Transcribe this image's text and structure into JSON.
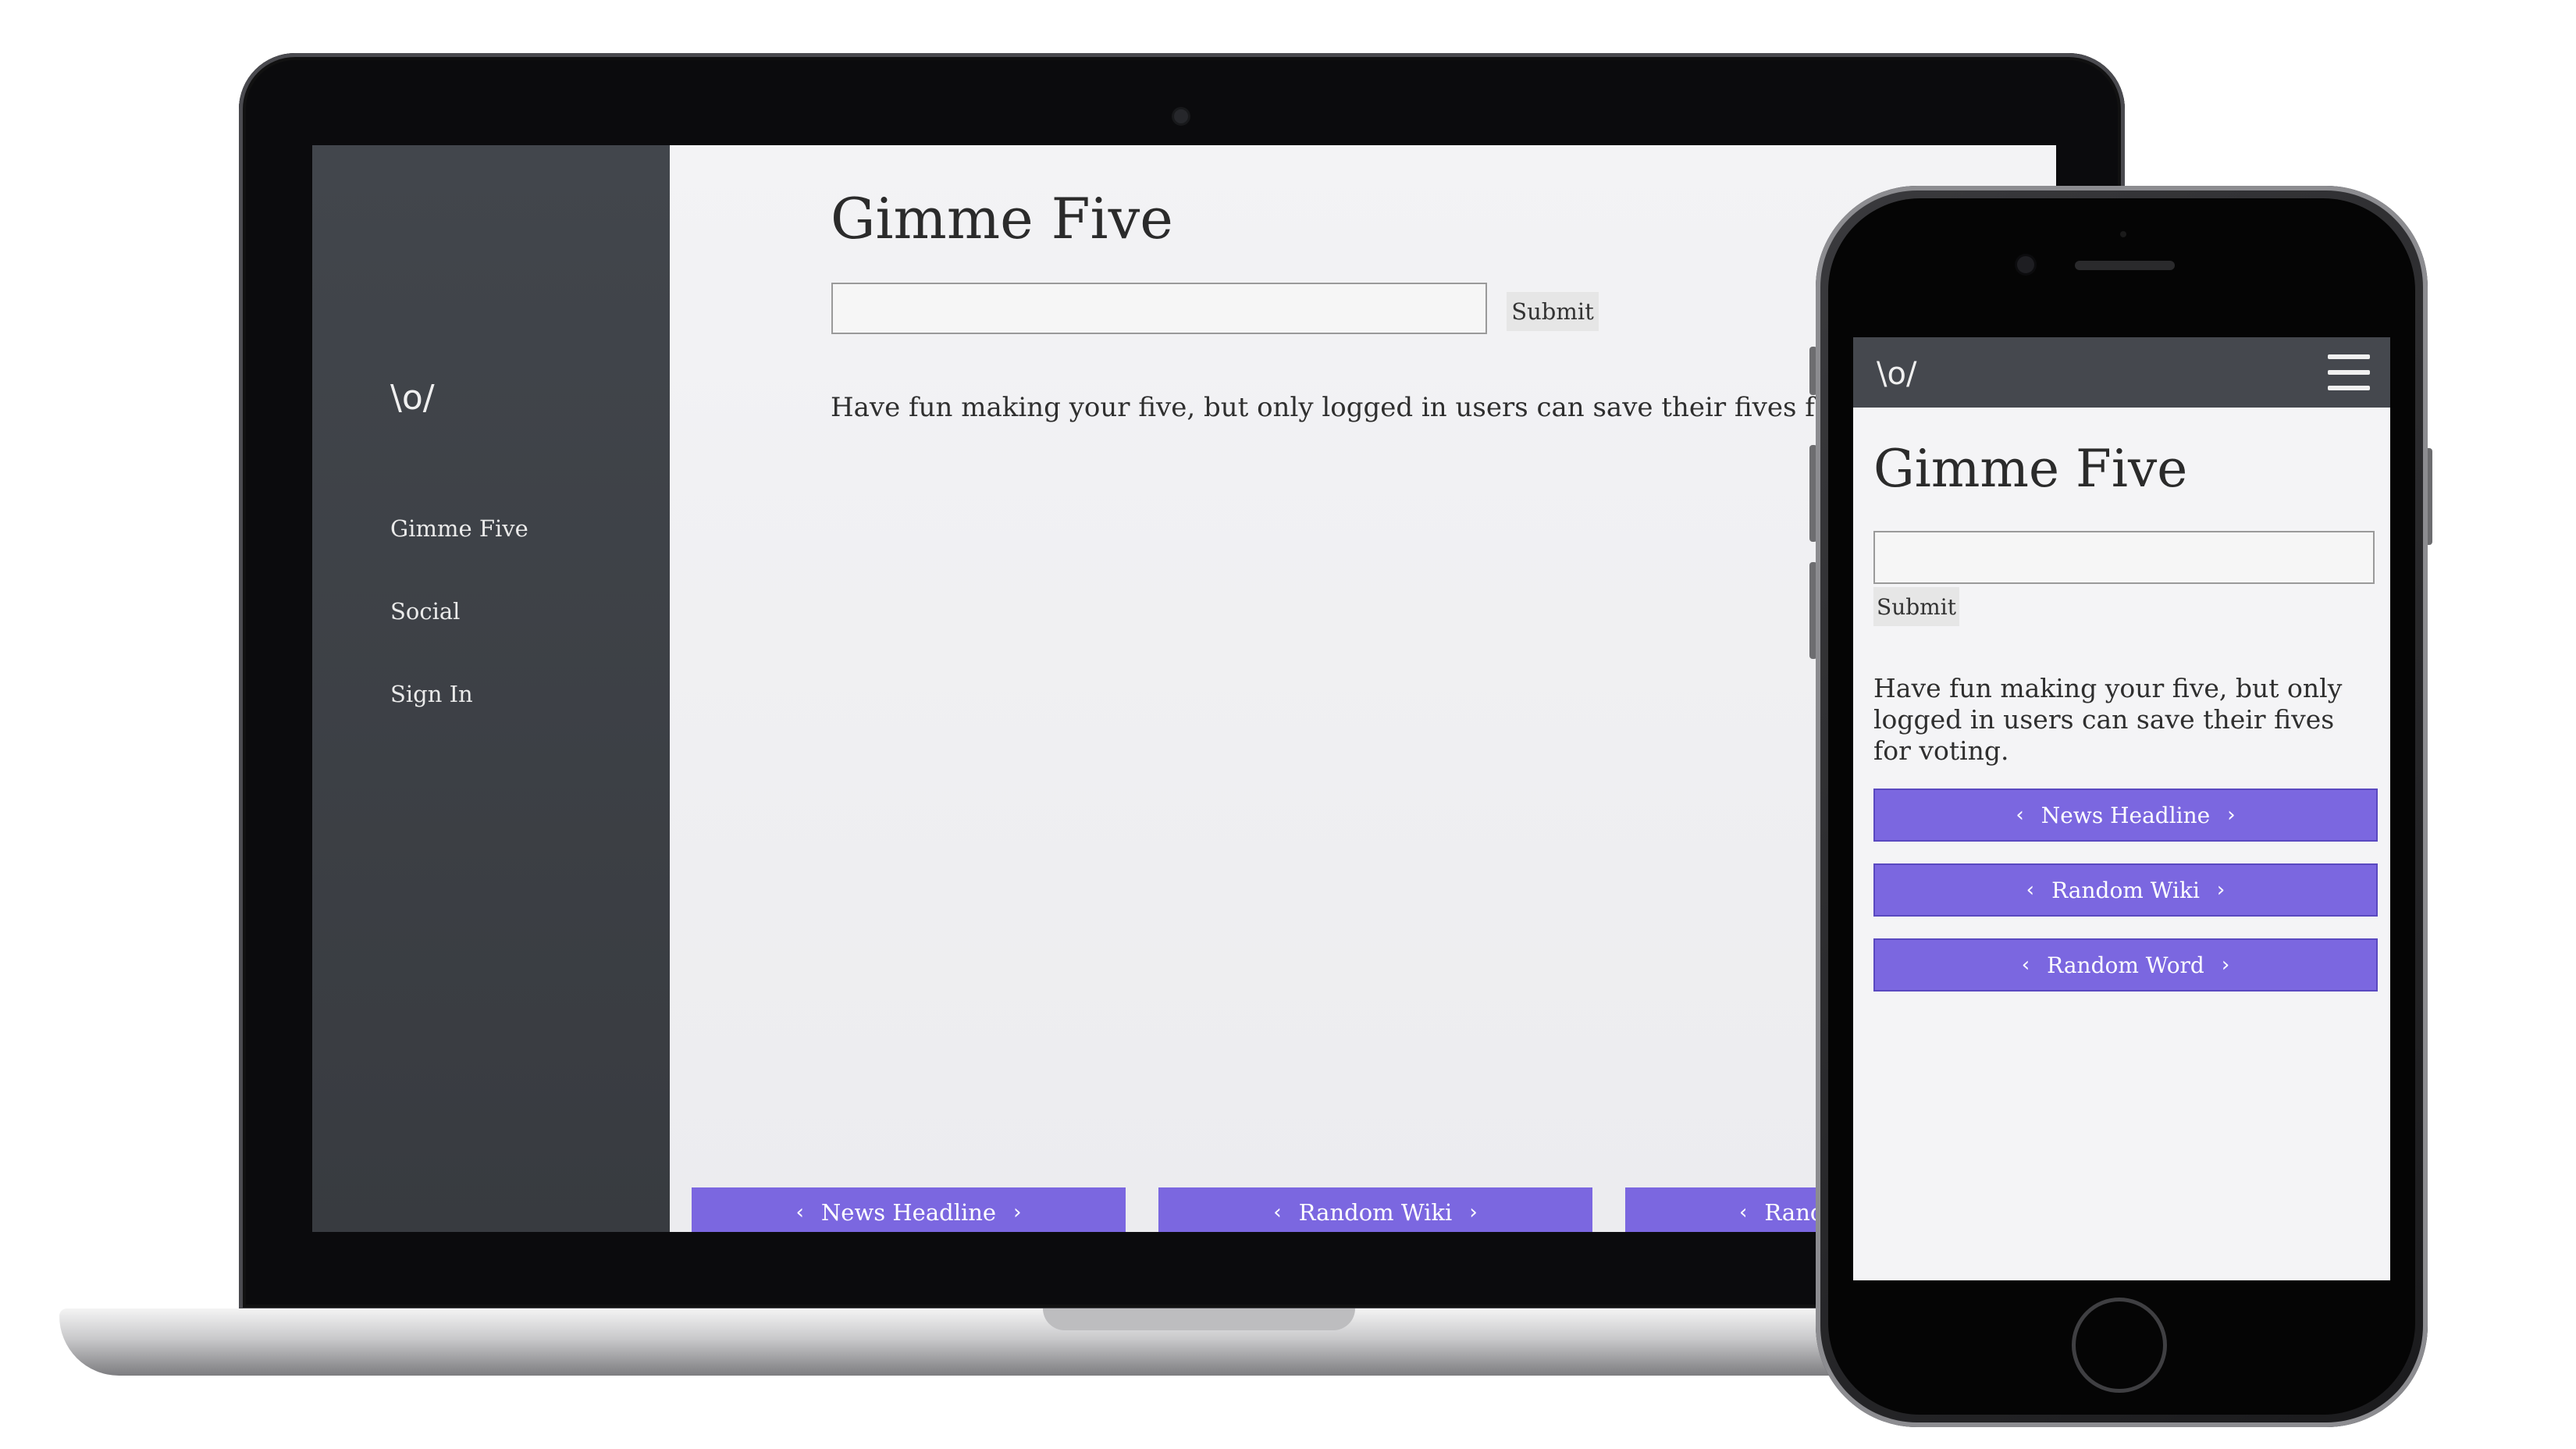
{
  "laptop": {
    "sidebar": {
      "logo": "\\o/",
      "items": [
        {
          "label": "Gimme Five"
        },
        {
          "label": "Social"
        },
        {
          "label": "Sign In"
        }
      ]
    },
    "main": {
      "title": "Gimme Five",
      "input_value": "",
      "submit_label": "Submit",
      "message": "Have fun making your five, but only logged in users can save their fives for v",
      "buttons": [
        {
          "label": "News Headline"
        },
        {
          "label": "Random Wiki"
        },
        {
          "label": "Rand"
        }
      ]
    }
  },
  "phone": {
    "topbar": {
      "logo": "\\o/",
      "menu_icon": "hamburger-menu-icon"
    },
    "main": {
      "title": "Gimme Five",
      "input_value": "",
      "submit_label": "Submit",
      "message": "Have fun making your five, but only logged in users can save their fives for voting.",
      "buttons": [
        {
          "label": "News Headline"
        },
        {
          "label": "Random Wiki"
        },
        {
          "label": "Random Word"
        }
      ]
    }
  },
  "icons": {
    "prev": "‹",
    "next": "›"
  },
  "colors": {
    "accent": "#7b67e0",
    "sidebar": "#3e4147",
    "page_background": "#f2f2f4",
    "text": "#2f2f2f"
  }
}
